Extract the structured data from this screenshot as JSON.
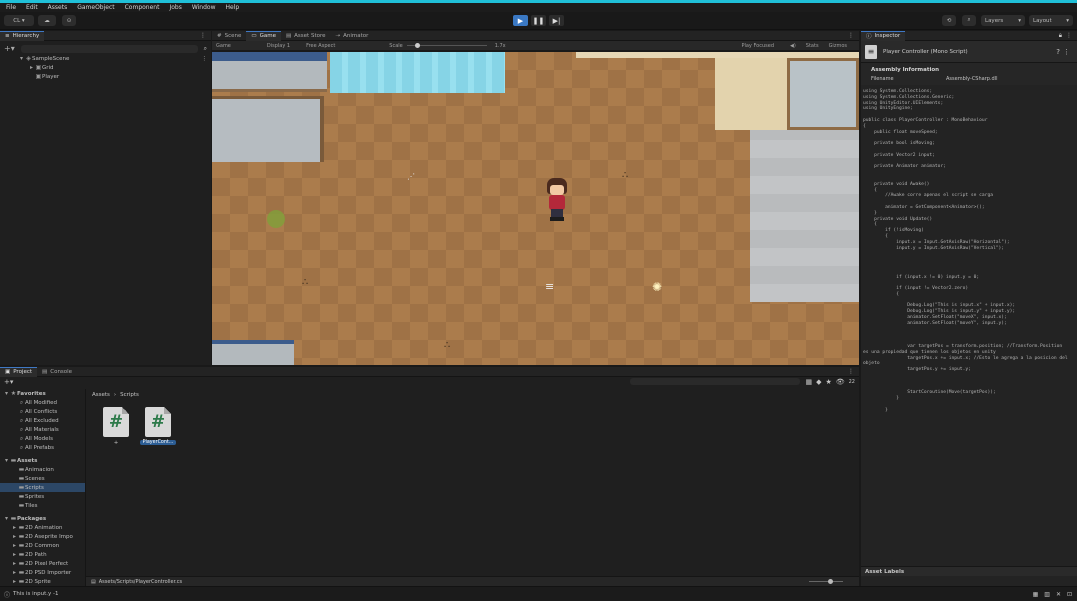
{
  "menu": [
    "File",
    "Edit",
    "Assets",
    "GameObject",
    "Component",
    "Jobs",
    "Window",
    "Help"
  ],
  "toolbar": {
    "account": "CL ▾",
    "layers": "Layers",
    "layout": "Layout"
  },
  "hierarchy": {
    "tab": "Hierarchy",
    "items": [
      {
        "label": "SampleScene",
        "depth": 0
      },
      {
        "label": "Grid",
        "depth": 1
      },
      {
        "label": "Player",
        "depth": 1
      }
    ]
  },
  "scene_tabs": [
    "Scene",
    "Game",
    "Asset Store",
    "Animator"
  ],
  "game_bar": {
    "display_mode": "Game",
    "display": "Display 1",
    "aspect": "Free Aspect",
    "scale_label": "Scale",
    "scale_value": "1.7x",
    "play_mode": "Play Focused",
    "stats": "Stats",
    "gizmos": "Gizmos"
  },
  "inspector": {
    "tab": "Inspector",
    "title": "Player Controller (Mono Script)",
    "section": "Assembly Information",
    "filename_label": "Filename",
    "filename_value": "Assembly-CSharp.dll",
    "code": [
      "using System.Collections;",
      "using System.Collections.Generic;",
      "using UnityEditor.UIElements;",
      "using UnityEngine;",
      "",
      "public class PlayerController : MonoBehaviour",
      "{",
      "    public float moveSpeed;",
      "",
      "    private bool isMoving;",
      "",
      "    private Vector2 input;",
      "",
      "    private Animator animator;",
      "",
      "",
      "    private void Awake()",
      "    {",
      "        //Awake corre apenas el script se carga",
      "",
      "        animator = GetComponent<Animator>();",
      "    }",
      "    private void Update()",
      "    {",
      "        if (!isMoving)",
      "        {",
      "            input.x = Input.GetAxisRaw(\"Horizontal\");",
      "            input.y = Input.GetAxisRaw(\"Vertical\");",
      "",
      "",
      "",
      "",
      "            if (input.x != 0) input.y = 0;",
      "",
      "            if (input != Vector2.zero)",
      "            {",
      "",
      "                Debug.Log(\"This is input.x\" + input.x);",
      "                Debug.Log(\"This is input.y\" + input.y);",
      "                animator.SetFloat(\"moveX\", input.x);",
      "                animator.SetFloat(\"moveY\", input.y);",
      "",
      "",
      "",
      "                var targetPos = transform.position; //Transform.Position",
      "es una propiedad que tienen los objetos en unity",
      "                targetPos.x += input.x; //Esto le agrega a la posicion del",
      "objeto",
      "                targetPos.y += input.y;",
      "",
      "",
      "",
      "                StartCoroutine(Move(targetPos));",
      "            }",
      "",
      "        }"
    ],
    "asset_labels": "Asset Labels"
  },
  "project": {
    "tabs": [
      "Project",
      "Console"
    ],
    "favorites_label": "Favorites",
    "favorites": [
      "All Modified",
      "All Conflicts",
      "All Excluded",
      "All Materials",
      "All Models",
      "All Prefabs"
    ],
    "assets_label": "Assets",
    "assets": [
      "Animacion",
      "Scenes",
      "Scripts",
      "Sprites",
      "Tiles"
    ],
    "packages_label": "Packages",
    "packages": [
      "2D Animation",
      "2D Aseprite Impo",
      "2D Common",
      "2D Path",
      "2D Pixel Perfect",
      "2D PSD Importer",
      "2D Sprite"
    ],
    "breadcrumb": [
      "Assets",
      "Scripts"
    ],
    "files": [
      {
        "name": "+",
        "icon": "#"
      },
      {
        "name": "PlayerCont...",
        "icon": "#"
      }
    ],
    "count": "22",
    "path": "Assets/Scripts/PlayerController.cs"
  },
  "status": {
    "message": "This is input.y -1"
  }
}
